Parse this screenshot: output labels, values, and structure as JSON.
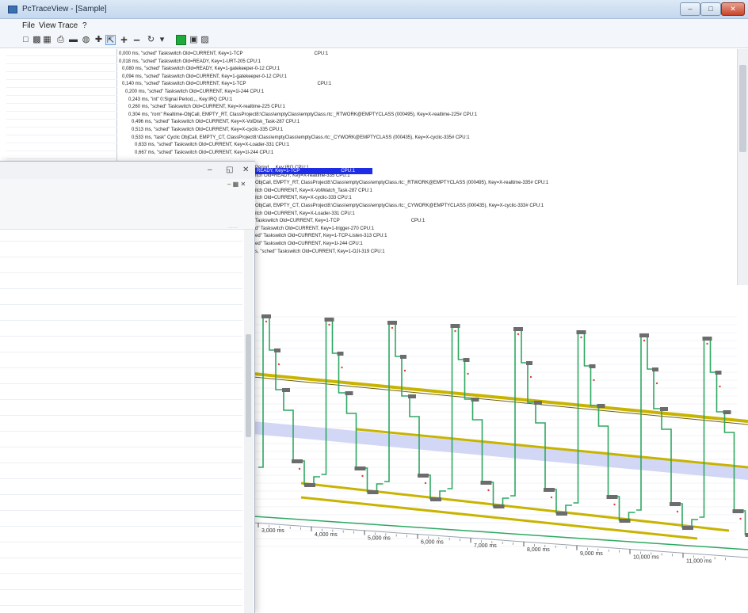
{
  "window": {
    "title": "PcTraceView - [Sample]"
  },
  "menu": [
    "File",
    "View",
    "Trace",
    "?"
  ],
  "toolbar": [
    {
      "icon": "new-file-icon"
    },
    {
      "icon": "open-folder-icon"
    },
    {
      "icon": "save-icon"
    },
    {
      "icon": "print-icon"
    },
    {
      "icon": "minus-icon"
    },
    {
      "icon": "find-icon"
    },
    {
      "icon": "crosshair-icon"
    },
    {
      "icon": "select-icon"
    },
    {
      "icon": "zoom-in-icon"
    },
    {
      "icon": "zoom-out-icon"
    },
    {
      "icon": "rewind-icon"
    },
    {
      "icon": "record-icon"
    },
    {
      "icon": "chart-icon"
    },
    {
      "icon": "export-icon"
    }
  ],
  "log_lines": [
    {
      "indent": 0,
      "text": "0,000 ms, \"sched\" Taskswitch Old=CURRENT, Key=1-TCP",
      "cpu": "CPU:1"
    },
    {
      "indent": 0,
      "text": "0,018 ms, \"sched\" Taskswitch Old=READY, Key=1-URT-205 CPU:1",
      "cpu": ""
    },
    {
      "indent": 1,
      "text": "0,080 ms, \"sched\" Taskswitch Old=READY, Key=1-gatekeeper-0-12 CPU:1",
      "cpu": ""
    },
    {
      "indent": 1,
      "text": "0,094 ms, \"sched\" Taskswitch Old=CURRENT, Key=1-gatekeeper-0-12 CPU:1",
      "cpu": ""
    },
    {
      "indent": 1,
      "text": "0,140 ms, \"sched\" Taskswitch Old=CURRENT, Key=1-TCP",
      "cpu": "CPU:1"
    },
    {
      "indent": 2,
      "text": "0,200 ms, \"sched\" Taskswitch Old=CURRENT, Key=1l-244 CPU:1",
      "cpu": ""
    },
    {
      "indent": 3,
      "text": "0,243 ms, \"int\" 0:Signal Period,,,, Key:IRQ CPU:1",
      "cpu": ""
    },
    {
      "indent": 3,
      "text": "0,260 ms, \"sched\" Taskswitch Old=CURRENT, Key=X-realtime-225 CPU:1",
      "cpu": ""
    },
    {
      "indent": 3,
      "text": "0,304 ms, \"rom\" Realtime-ObjCall, EMPTY_RT, ClassProject8:\\Class\\emptyClass\\emptyClass.rtc:_RTWORK@EMPTYCLASS (000495), Key=X-realtime-225# CPU:1",
      "cpu": ""
    },
    {
      "indent": 4,
      "text": "0,496 ms, \"sched\" Taskswitch Old=CURRENT, Key=X-VolDisk_Task-287 CPU:1",
      "cpu": ""
    },
    {
      "indent": 4,
      "text": "0,513 ms, \"sched\" Taskswitch Old=CURRENT, Key=X-cyclic-335 CPU:1",
      "cpu": ""
    },
    {
      "indent": 4,
      "text": "0,533 ms, \"task\" Cyclic ObjCall, EMPTY_CT, ClassProject8:\\Class\\emptyClass\\emptyClass.rtc:_CYWORK@EMPTYCLASS (000435), Key=X-cyclic-335# CPU:1",
      "cpu": ""
    },
    {
      "indent": 5,
      "text": "0,633 ms, \"sched\" Taskswitch Old=CURRENT, Key=X-Loader-331 CPU:1",
      "cpu": ""
    },
    {
      "indent": 5,
      "text": "0,667 ms, \"sched\" Taskswitch Old=CURRENT, Key=1l-244 CPU:1",
      "cpu": ""
    },
    {
      "indent": 6,
      "text": "",
      "cpu": ""
    },
    {
      "indent": 6,
      "text": "Period,,,, Key:IRQ CPU:1",
      "cpu": ""
    },
    {
      "indent": 6,
      "text": "itch Old=READY, Key=X-realtime-335 CPU:1",
      "cpu": ""
    },
    {
      "indent": 6,
      "text": "ObjCall, EMPTY_RT, ClassProject8:\\Class\\emptyClass\\emptyClass.rtc:_RTWORK@EMPTYCLASS (000495), Key=X-realtime-335# CPU:1",
      "cpu": ""
    },
    {
      "indent": 6,
      "text": "itch Old=CURRENT, Key=X-VolWatch_Task-287 CPU:1",
      "cpu": ""
    },
    {
      "indent": 6,
      "text": "itch Old=CURRENT, Key=X-cyclic-333 CPU:1",
      "cpu": ""
    },
    {
      "indent": 6,
      "text": "ObjCall, EMPTY_CT, ClassProject8:\\Class\\emptyClass\\emptyClass.rtc:_CYWORK@EMPTYCLASS (000435), Key=X-cyclic-333# CPU:1",
      "cpu": ""
    },
    {
      "indent": 6,
      "text": "itch Old=CURRENT, Key=X-Loader-331 CPU:1",
      "cpu": ""
    },
    {
      "indent": 6,
      "text": "Taskswitch Old=CURRENT, Key=1-TCP",
      "cpu": "CPU:1"
    },
    {
      "indent": 6,
      "text": "d\" Taskswitch Old=CURRENT, Key=1-trigger-270 CPU:1",
      "cpu": ""
    },
    {
      "indent": 6,
      "text": "ed\" Taskswitch Old=CURRENT, Key=1-TCP-Listen-313 CPU:1",
      "cpu": ""
    },
    {
      "indent": 6,
      "text": "ed\" Taskswitch Old=CURRENT, Key=1l-244 CPU:1",
      "cpu": ""
    },
    {
      "indent": 6,
      "text": "s, \"sched\" Taskswitch Old=CURRENT, Key=1-OJI-319 CPU:1",
      "cpu": ""
    }
  ],
  "selected_line": {
    "text": "READY, Key=1-TCP",
    "cpu": "CPU:1"
  },
  "chart_data": {
    "type": "line",
    "xlabel": "",
    "ylabel": "",
    "x_ticks": [
      "3,000 ms",
      "4,000 ms",
      "5,000 ms",
      "6,000 ms",
      "7,000 ms",
      "8,000 ms",
      "9,000 ms",
      "10,000 ms",
      "11,000 ms"
    ],
    "series": [
      {
        "color": "#2ea862"
      },
      {
        "color": "#c8b400"
      },
      {
        "color": "#c3c9f2"
      }
    ],
    "bursts": 8
  }
}
